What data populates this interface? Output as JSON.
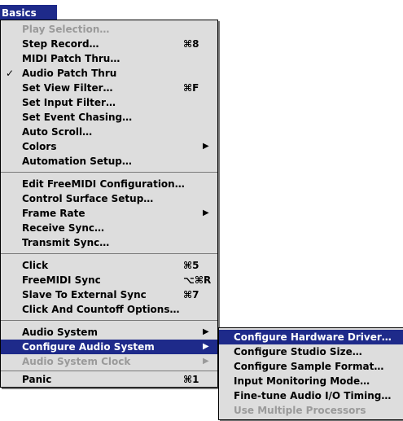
{
  "menu_title": "Basics",
  "items": [
    {
      "label": "Play Selection…",
      "disabled": true
    },
    {
      "label": "Step Record…",
      "shortcut": "⌘8"
    },
    {
      "label": "MIDI Patch Thru…"
    },
    {
      "label": "Audio Patch Thru",
      "checked": "✓"
    },
    {
      "label": "Set View Filter…",
      "shortcut": "⌘F"
    },
    {
      "label": "Set Input Filter…"
    },
    {
      "label": "Set Event Chasing…"
    },
    {
      "label": "Auto Scroll…"
    },
    {
      "label": "Colors",
      "submenu": true
    },
    {
      "label": "Automation Setup…"
    },
    {
      "label": "Edit FreeMIDI Configuration…"
    },
    {
      "label": "Control Surface Setup…"
    },
    {
      "label": "Frame Rate",
      "submenu": true
    },
    {
      "label": "Receive Sync…"
    },
    {
      "label": "Transmit Sync…"
    },
    {
      "label": "Click",
      "shortcut": "⌘5"
    },
    {
      "label": "FreeMIDI Sync",
      "shortcut": "⌥⌘R"
    },
    {
      "label": "Slave To External Sync",
      "shortcut": "⌘7"
    },
    {
      "label": "Click And Countoff Options…"
    },
    {
      "label": "Audio System",
      "submenu": true
    },
    {
      "label": "Configure Audio System",
      "submenu": true,
      "highlighted": true
    },
    {
      "label": "Audio System Clock",
      "submenu": true,
      "disabled": true
    },
    {
      "label": "Panic",
      "shortcut": "⌘1"
    }
  ],
  "submenu_items": [
    {
      "label": "Configure Hardware Driver…",
      "highlighted": true
    },
    {
      "label": "Configure Studio Size…"
    },
    {
      "label": "Configure Sample Format…"
    },
    {
      "label": "Input Monitoring Mode…"
    },
    {
      "label": "Fine-tune Audio I/O Timing…"
    },
    {
      "label": "Use Multiple Processors",
      "disabled": true
    }
  ],
  "colors": {
    "highlight": "#1e2a8a",
    "menu_bg": "#dddddd",
    "disabled": "#9a9a9a"
  }
}
